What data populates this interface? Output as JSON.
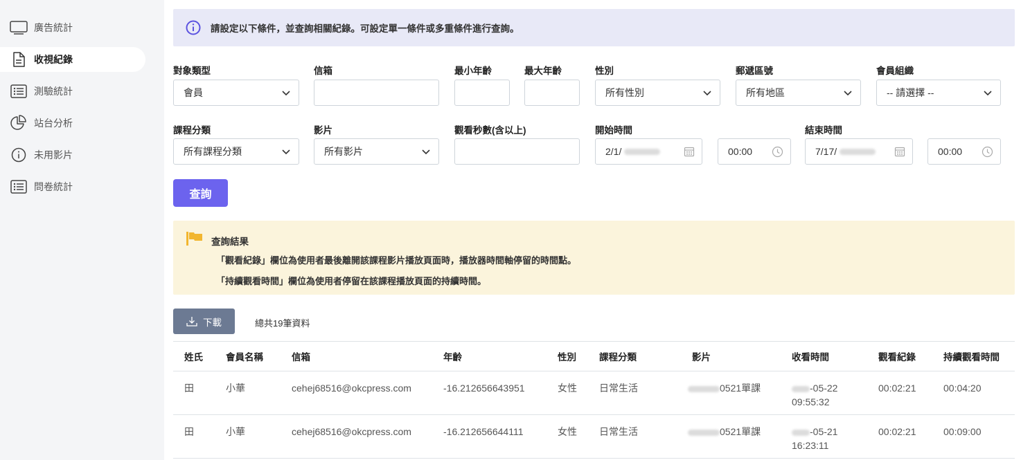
{
  "sidebar": {
    "items": [
      {
        "label": "廣告統計",
        "icon": "monitor-icon"
      },
      {
        "label": "收視紀錄",
        "icon": "document-icon",
        "active": true
      },
      {
        "label": "測驗統計",
        "icon": "list-icon"
      },
      {
        "label": "站台分析",
        "icon": "pie-chart-icon"
      },
      {
        "label": "未用影片",
        "icon": "info-circle-icon"
      },
      {
        "label": "問卷統計",
        "icon": "list-icon"
      }
    ]
  },
  "info": {
    "text": "請設定以下條件，並查詢相關紀錄。可設定單一條件或多重條件進行查詢。",
    "icon": "info-circle-icon"
  },
  "filters": {
    "target_type": {
      "label": "對象類型",
      "value": "會員"
    },
    "email": {
      "label": "信箱",
      "value": ""
    },
    "min_age": {
      "label": "最小年齡",
      "value": ""
    },
    "max_age": {
      "label": "最大年齡",
      "value": ""
    },
    "gender": {
      "label": "性別",
      "value": "所有性別"
    },
    "zipcode": {
      "label": "郵遞區號",
      "value": "所有地區"
    },
    "org": {
      "label": "會員組織",
      "value": "-- 請選擇 --"
    },
    "course_category": {
      "label": "課程分類",
      "value": "所有課程分類"
    },
    "video": {
      "label": "影片",
      "value": "所有影片"
    },
    "watch_seconds": {
      "label": "觀看秒數(含以上)",
      "value": ""
    },
    "start": {
      "label": "開始時間",
      "date": "2/1/",
      "time": "00:00"
    },
    "end": {
      "label": "結束時間",
      "date": "7/17/",
      "time": "00:00"
    }
  },
  "query_button": "查詢",
  "result": {
    "title": "查詢結果",
    "line1": "「觀看紀錄」欄位為使用者最後離開該課程影片播放頁面時，播放器時間軸停留的時間點。",
    "line2": "「持續觀看時間」欄位為使用者停留在該課程播放頁面的持續時間。"
  },
  "download_button": "下載",
  "total_text": "總共19筆資料",
  "table": {
    "headers": [
      "姓氏",
      "會員名稱",
      "信箱",
      "年齡",
      "性別",
      "課程分類",
      "影片",
      "收看時間",
      "觀看紀錄",
      "持續觀看時間"
    ],
    "rows": [
      {
        "surname": "田",
        "name": "小華",
        "email": "cehej68516@okcpress.com",
        "age": "-16.212656643951",
        "gender": "女性",
        "category": "日常生活",
        "video": "0521單課",
        "watch_date": "-05-22",
        "watch_time": "09:55:32",
        "record": "00:02:21",
        "duration": "00:04:20"
      },
      {
        "surname": "田",
        "name": "小華",
        "email": "cehej68516@okcpress.com",
        "age": "-16.212656644111",
        "gender": "女性",
        "category": "日常生活",
        "video": "0521單課",
        "watch_date": "-05-21",
        "watch_time": "16:23:11",
        "record": "00:02:21",
        "duration": "00:09:00"
      }
    ]
  },
  "colors": {
    "primary": "#6c63ee",
    "info_bg": "#e8e9f7",
    "result_bg": "#fbf4dc",
    "flag": "#f2b62f",
    "download_bg": "#6c7a93"
  }
}
